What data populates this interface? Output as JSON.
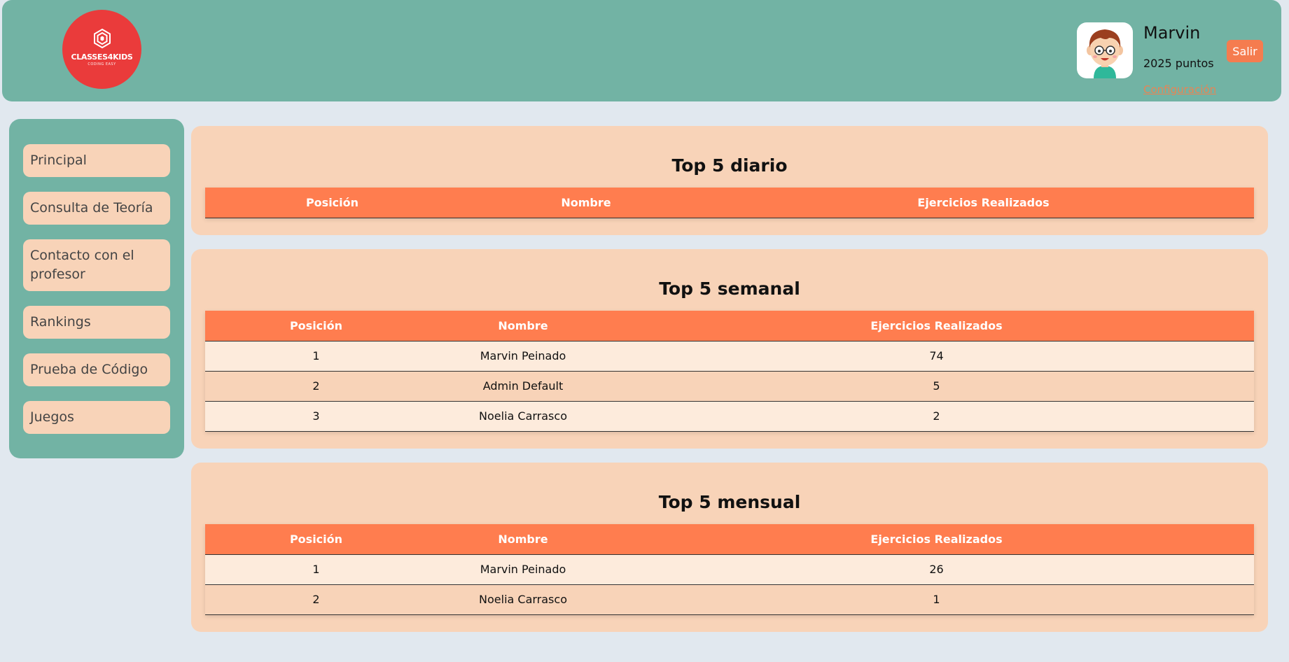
{
  "header": {
    "logo_text": "CLASSES4KIDS",
    "logo_sub": "CODING EASY",
    "user_name": "Marvin",
    "user_points": "2025 puntos",
    "config_link": "Configuración",
    "logout_label": "Salir"
  },
  "sidebar": {
    "items": [
      {
        "label": "Principal"
      },
      {
        "label": "Consulta de Teoría"
      },
      {
        "label": "Contacto con el profesor"
      },
      {
        "label": "Rankings"
      },
      {
        "label": "Prueba de Código"
      },
      {
        "label": "Juegos"
      }
    ]
  },
  "rankings": {
    "columns": [
      "Posición",
      "Nombre",
      "Ejercicios Realizados"
    ],
    "daily": {
      "title": "Top 5 diario",
      "rows": []
    },
    "weekly": {
      "title": "Top 5 semanal",
      "rows": [
        [
          "1",
          "Marvin Peinado",
          "74"
        ],
        [
          "2",
          "Admin Default",
          "5"
        ],
        [
          "3",
          "Noelia Carrasco",
          "2"
        ]
      ]
    },
    "monthly": {
      "title": "Top 5 mensual",
      "rows": [
        [
          "1",
          "Marvin Peinado",
          "26"
        ],
        [
          "2",
          "Noelia Carrasco",
          "1"
        ]
      ]
    }
  },
  "colors": {
    "header_bg": "#72b3a4",
    "accent": "#ff7d4f",
    "card_bg": "#f8d3b8",
    "logo_bg": "#ea3b3b"
  }
}
